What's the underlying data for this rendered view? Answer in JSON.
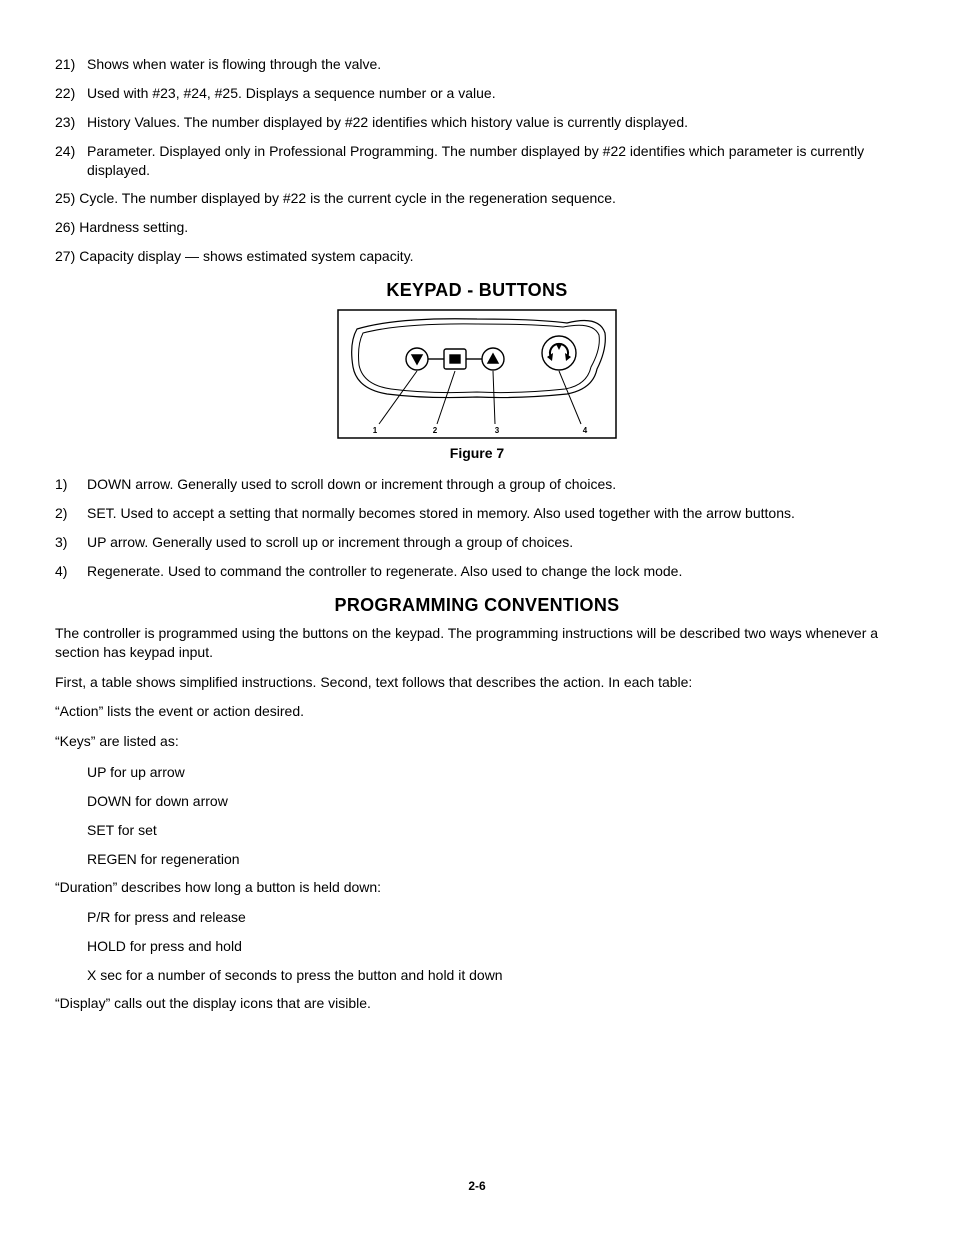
{
  "list1": [
    {
      "n": "21)",
      "t": "Shows when water is flowing through the valve."
    },
    {
      "n": "22)",
      "t": "Used with #23, #24, #25.  Displays a sequence number or a value."
    },
    {
      "n": "23)",
      "t": "History Values.  The number displayed by #22 identifies which history value is currently displayed."
    },
    {
      "n": "24)",
      "t": "Parameter.  Displayed only in Professional Programming.  The number displayed by #22 identifies which parameter is currently displayed."
    },
    {
      "n": "25)",
      "t": "Cycle.  The number displayed by #22 is the current cycle in the regeneration sequence.",
      "nogap": true
    },
    {
      "n": "26)",
      "t": "Hardness setting.",
      "nogap": true
    },
    {
      "n": "27)",
      "t": "Capacity display — shows estimated system capacity.",
      "nogap": true
    }
  ],
  "heading_keypad": "KEYPAD - BUTTONS",
  "figure_label": "Figure 7",
  "keypad_numbers": [
    "1",
    "2",
    "3",
    "4"
  ],
  "list2": [
    {
      "n": "1)",
      "t": "DOWN arrow.  Generally used to scroll down or increment through a group of choices."
    },
    {
      "n": "2)",
      "t": "SET.  Used to accept a setting that normally becomes stored in memory.  Also used together with the arrow buttons."
    },
    {
      "n": "3)",
      "t": "UP arrow.  Generally used to scroll up or increment through a group of choices."
    },
    {
      "n": "4)",
      "t": "Regenerate.  Used to command the controller to regenerate.  Also used to change the lock mode."
    }
  ],
  "heading_prog": "PROGRAMMING CONVENTIONS",
  "para_intro": "The controller is programmed using the buttons on the keypad.  The programming instructions will be described two ways whenever a section has keypad input.",
  "para_first": "First, a table shows simplified instructions.  Second, text follows that describes the action.  In each table:",
  "para_action": "“Action” lists the event or action desired.",
  "para_keys_head": "“Keys” are listed as:",
  "keys_list": [
    "UP for up arrow",
    "DOWN for down arrow",
    "SET for set",
    "REGEN for regeneration"
  ],
  "para_duration_head": "“Duration” describes how long a button is held down:",
  "duration_list": [
    "P/R for press and release",
    "HOLD for press and hold",
    "X sec for a number of seconds to press the button and hold it down"
  ],
  "para_display": "“Display” calls out the display icons that are visible.",
  "page_footer": "2-6"
}
